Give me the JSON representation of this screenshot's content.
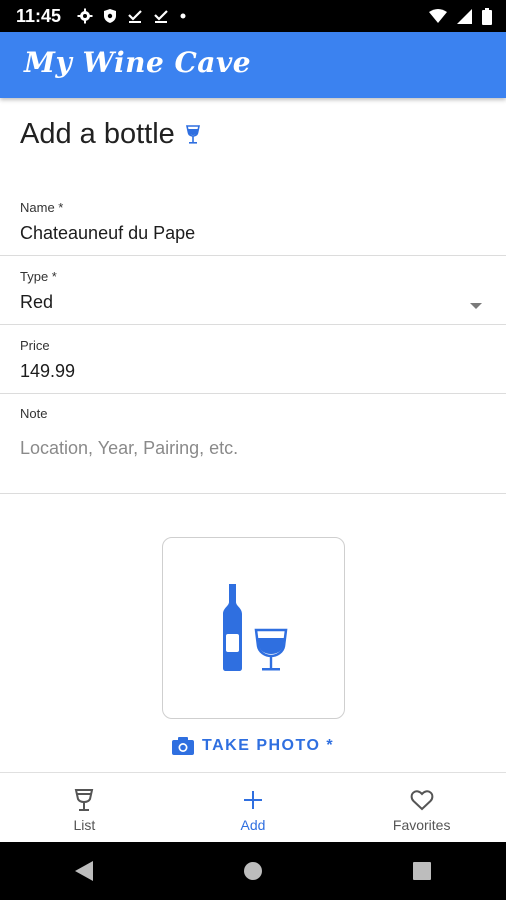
{
  "status_bar": {
    "time": "11:45",
    "icons": [
      "gear-icon",
      "shield-icon",
      "download-done-icon",
      "download-done-icon",
      "dot-icon"
    ],
    "right_icons": [
      "wifi-icon",
      "signal-icon",
      "battery-icon"
    ]
  },
  "app_bar": {
    "title": "My Wine Cave",
    "color": "#3b82f0"
  },
  "page": {
    "heading": "Add a bottle"
  },
  "form": {
    "name": {
      "label": "Name *",
      "value": "Chateauneuf du Pape"
    },
    "type": {
      "label": "Type *",
      "value": "Red"
    },
    "price": {
      "label": "Price",
      "value": "149.99"
    },
    "note": {
      "label": "Note",
      "placeholder": "Location, Year, Pairing, etc."
    }
  },
  "photo": {
    "take_photo_label": "TAKE PHOTO *"
  },
  "bottom_nav": {
    "items": [
      {
        "label": "List",
        "icon": "wine-glass-icon",
        "active": false
      },
      {
        "label": "Add",
        "icon": "plus-icon",
        "active": true
      },
      {
        "label": "Favorites",
        "icon": "heart-icon",
        "active": false
      }
    ]
  },
  "system_nav": {
    "buttons": [
      "back-icon",
      "home-icon",
      "recents-icon"
    ]
  },
  "colors": {
    "accent": "#2f6fe0",
    "app_bar": "#3b82f0"
  }
}
